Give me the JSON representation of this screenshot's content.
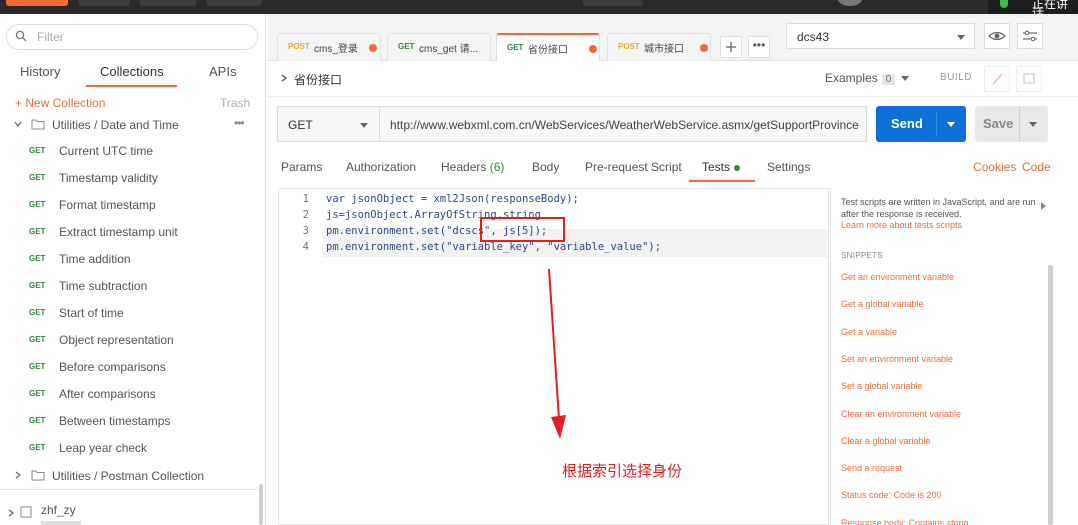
{
  "app": {
    "top_status": "正在讲话",
    "brand_color": "#f26b3a",
    "send_color": "#0d6fd8"
  },
  "sidebar": {
    "filter_placeholder": "Filter",
    "tabs": [
      "History",
      "Collections",
      "APIs"
    ],
    "active_tab": "Collections",
    "new_collection": "+ New Collection",
    "trash": "Trash",
    "folder_open": "Utilities / Date and Time",
    "requests": [
      {
        "method": "GET",
        "name": "Current UTC time"
      },
      {
        "method": "GET",
        "name": "Timestamp validity"
      },
      {
        "method": "GET",
        "name": "Format timestamp"
      },
      {
        "method": "GET",
        "name": "Extract timestamp unit"
      },
      {
        "method": "GET",
        "name": "Time addition"
      },
      {
        "method": "GET",
        "name": "Time subtraction"
      },
      {
        "method": "GET",
        "name": "Start of time"
      },
      {
        "method": "GET",
        "name": "Object representation"
      },
      {
        "method": "GET",
        "name": "Before comparisons"
      },
      {
        "method": "GET",
        "name": "After comparisons"
      },
      {
        "method": "GET",
        "name": "Between timestamps"
      },
      {
        "method": "GET",
        "name": "Leap year check"
      }
    ],
    "folder_closed": "Utilities / Postman Collection",
    "workspace": "zhf_zy"
  },
  "tabs": [
    {
      "method": "POST",
      "title": "cms_登录",
      "method_color": "#f5a623",
      "dirty": true
    },
    {
      "method": "GET",
      "title": "cms_get 请...",
      "method_color": "#2e8b3a",
      "dirty": false
    },
    {
      "method": "GET",
      "title": "省份接口",
      "method_color": "#2e8b3a",
      "dirty": true,
      "active": true
    },
    {
      "method": "POST",
      "title": "城市接口",
      "method_color": "#f5a623",
      "dirty": true
    }
  ],
  "environment": {
    "selected": "dcs43"
  },
  "request": {
    "title": "省份接口",
    "examples_label": "Examples",
    "examples_count": "0",
    "build_label": "BUILD",
    "method": "GET",
    "url": "http://www.webxml.com.cn/WebServices/WeatherWebService.asmx/getSupportProvince",
    "send_label": "Send",
    "save_label": "Save"
  },
  "request_tabs": [
    {
      "label": "Params"
    },
    {
      "label": "Authorization"
    },
    {
      "label": "Headers",
      "count": "(6)"
    },
    {
      "label": "Body"
    },
    {
      "label": "Pre-request Script"
    },
    {
      "label": "Tests",
      "active": true
    },
    {
      "label": "Settings"
    }
  ],
  "right_links": {
    "cookies": "Cookies",
    "code": "Code"
  },
  "editor": {
    "lines": [
      {
        "no": "1",
        "code": "var jsonObject = xml2Json(responseBody);"
      },
      {
        "no": "2",
        "code": "js=jsonObject.ArrayOfString.string"
      },
      {
        "no": "3",
        "code": "pm.environment.set(\"dcscs\", js[5]);"
      },
      {
        "no": "4",
        "code": "pm.environment.set(\"variable_key\", \"variable_value\");"
      }
    ]
  },
  "annotation": {
    "text": "根据索引选择身份",
    "color": "#e02020"
  },
  "snippets": {
    "description": "Test scripts are written in JavaScript, and are run after the response is received.",
    "learn_more": "Learn more about tests scripts",
    "header": "SNIPPETS",
    "items": [
      "Get an environment variable",
      "Get a global variable",
      "Get a variable",
      "Set an environment variable",
      "Set a global variable",
      "Clear an environment variable",
      "Clear a global variable",
      "Send a request",
      "Status code: Code is 200",
      "Response body: Contains string"
    ]
  }
}
